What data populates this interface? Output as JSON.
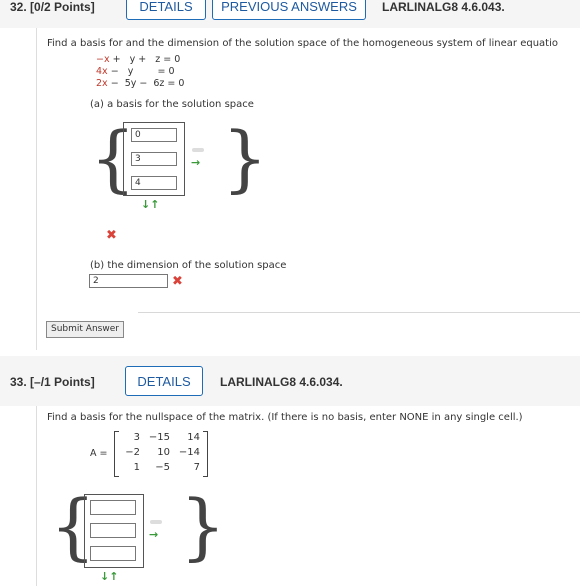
{
  "q32": {
    "number": "32.",
    "points": "[0/2 Points]",
    "details_label": "DETAILS",
    "prev_label": "PREVIOUS ANSWERS",
    "code": "LARLINALG8 4.6.043.",
    "prompt": "Find a basis for and the dimension of the solution space of the homogeneous system of linear equatio",
    "eq1": "−x +   y +   z = 0",
    "eq2": "4x −   y         = 0",
    "eq3": "2x −  5y −  6z = 0",
    "part_a": "(a) a basis for the solution space",
    "vector": [
      "0",
      "3",
      "4"
    ],
    "part_b": "(b) the dimension of the solution space",
    "dimension": "2",
    "submit_label": "Submit Answer"
  },
  "q33": {
    "number": "33.",
    "points": "[–/1 Points]",
    "details_label": "DETAILS",
    "code": "LARLINALG8 4.6.034.",
    "prompt": "Find a basis for the nullspace of the matrix. (If there is no basis, enter NONE in any single cell.)",
    "matrix_label": "A =",
    "matrix": [
      [
        "3",
        "−15",
        "14"
      ],
      [
        "−2",
        "10",
        "−14"
      ],
      [
        "1",
        "−5",
        "7"
      ]
    ],
    "vector": [
      "",
      "",
      ""
    ]
  },
  "icons": {
    "wrong": "✖",
    "add": "⬅",
    "updown": "↓↑"
  },
  "colors": {
    "accent": "#1e6bb8",
    "wrong": "#d9433a",
    "green": "#3a9a3a"
  }
}
